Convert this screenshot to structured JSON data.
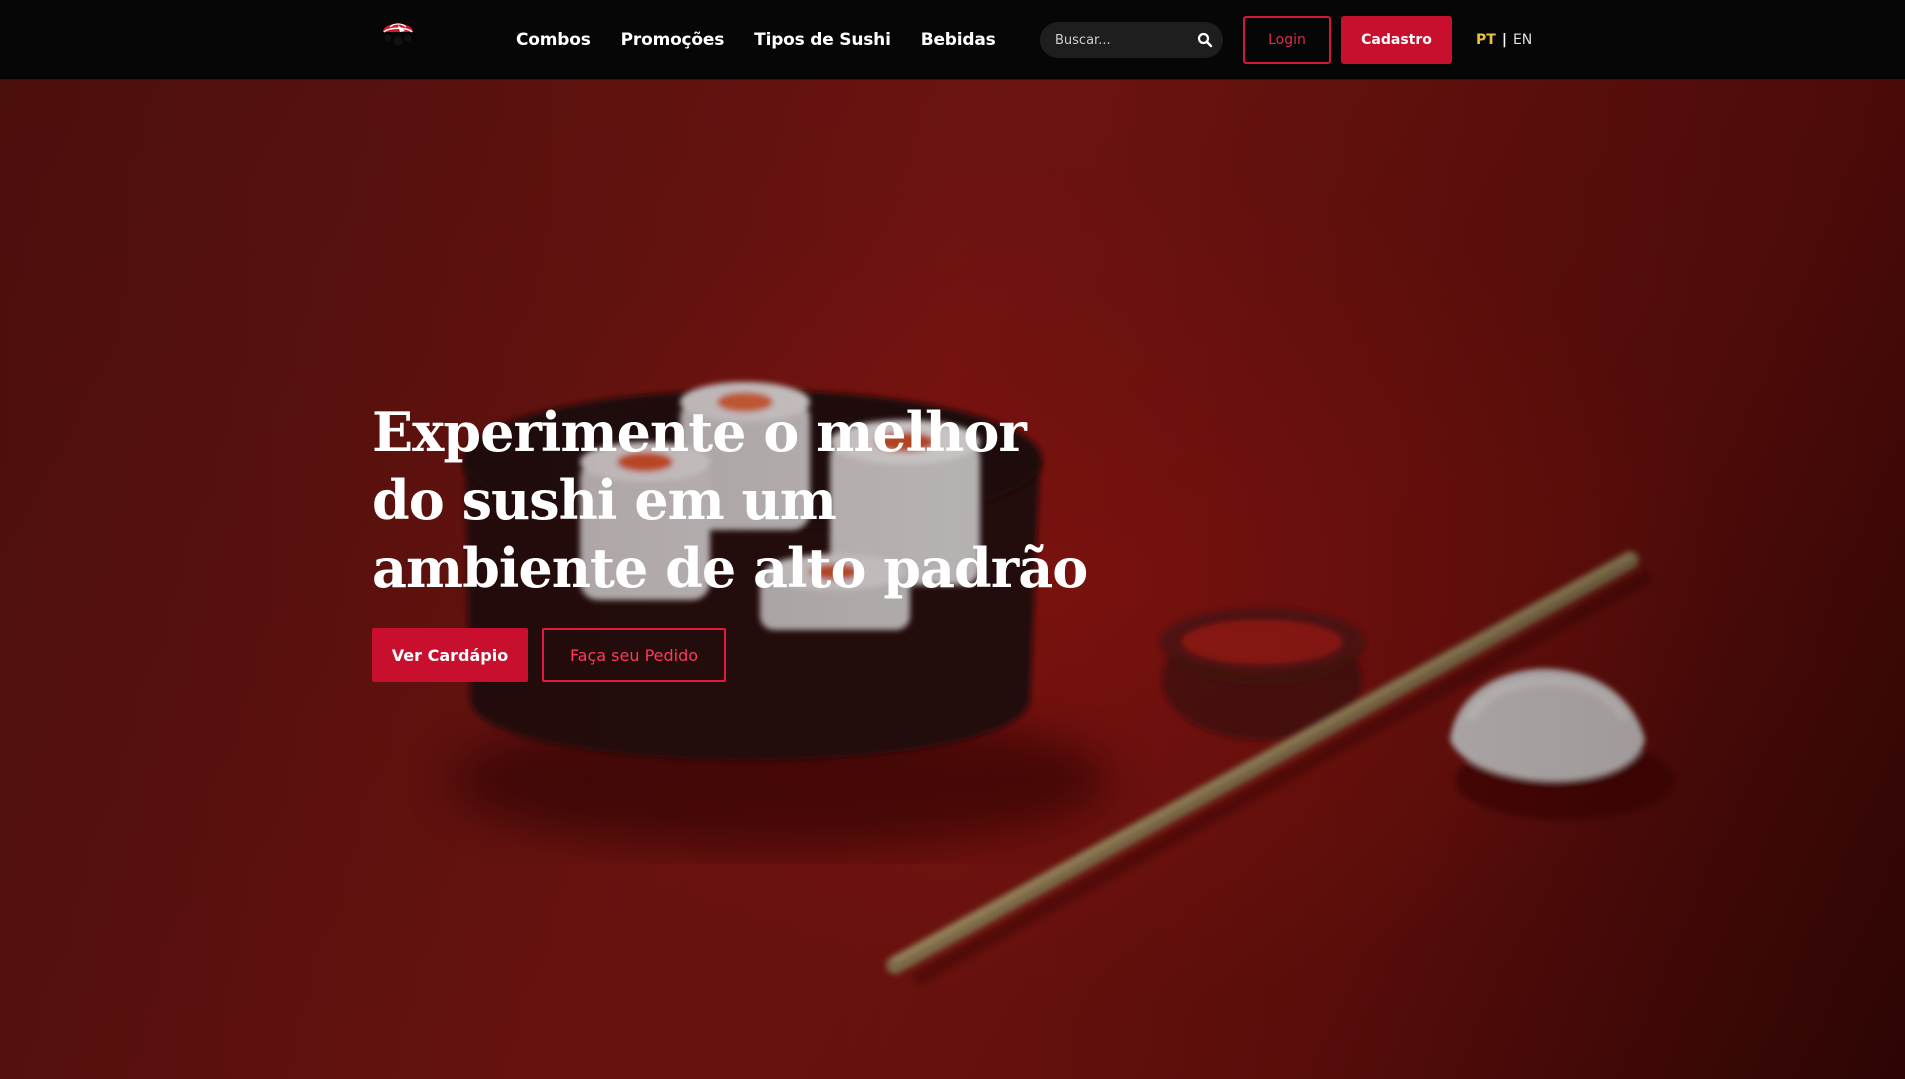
{
  "nav": {
    "links": [
      {
        "label": "Combos"
      },
      {
        "label": "Promoções"
      },
      {
        "label": "Tipos de Sushi"
      },
      {
        "label": "Bebidas"
      }
    ],
    "search_placeholder": "Buscar...",
    "login_label": "Login",
    "signup_label": "Cadastro",
    "lang_pt": "PT",
    "lang_sep": "|",
    "lang_en": "EN"
  },
  "hero": {
    "title": "Experimente o melhor do sushi em um ambiente de alto padrão",
    "primary_button": "Ver Cardápio",
    "secondary_button": "Faça seu Pedido"
  },
  "colors": {
    "accent": "#c8102e",
    "navbar_bg": "#060606",
    "active_lang": "#e9c43a",
    "hero_bg": "#7a1612"
  },
  "icons": {
    "logo": "sushi-logo-icon",
    "search": "search-icon"
  }
}
